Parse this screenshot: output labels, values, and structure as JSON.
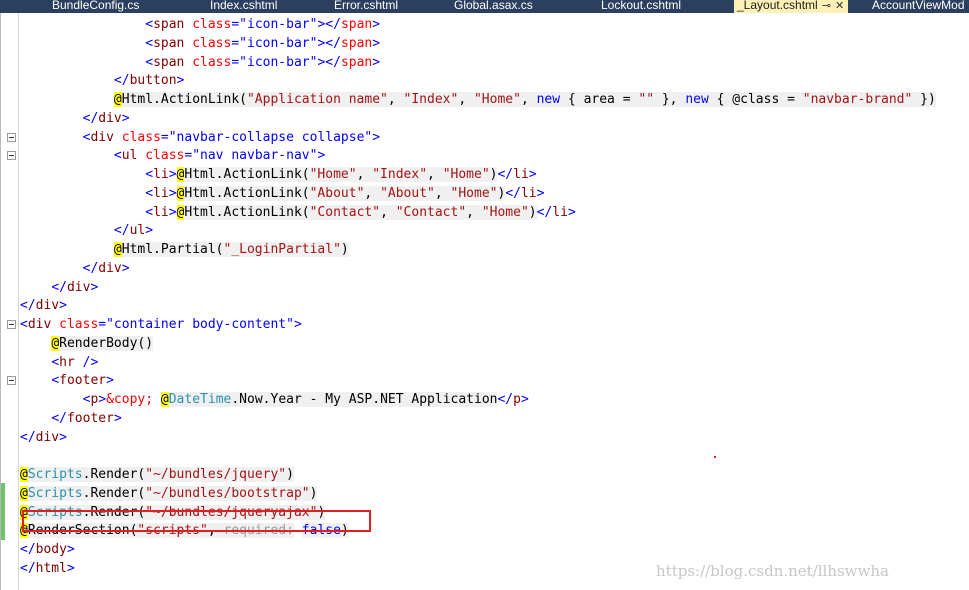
{
  "tabs": [
    {
      "label": "BundleConfig.cs",
      "active": false
    },
    {
      "label": "Index.cshtml",
      "active": false
    },
    {
      "label": "Error.cshtml",
      "active": false
    },
    {
      "label": "Global.asax.cs",
      "active": false
    },
    {
      "label": "Lockout.cshtml",
      "active": false
    },
    {
      "label": "_Layout.cshtml",
      "active": true
    },
    {
      "label": "AccountViewMod",
      "active": false
    }
  ],
  "tab_icons": {
    "pin": "pin-icon",
    "close": "close-icon"
  },
  "tab_glyphs": {
    "pin": "⊸",
    "close": "✕"
  },
  "lines": [
    [
      "                ",
      "<",
      "span",
      " ",
      "class",
      "=",
      "\"icon-bar\"",
      "></",
      "span",
      ">"
    ],
    [
      "                ",
      "<",
      "span",
      " ",
      "class",
      "=",
      "\"icon-bar\"",
      "></",
      "span",
      ">"
    ],
    [
      "                ",
      "<",
      "span",
      " ",
      "class",
      "=",
      "\"icon-bar\"",
      "></",
      "span",
      ">"
    ],
    [
      "            ",
      "</",
      "button",
      ">"
    ],
    [
      "            ",
      "@",
      "Html.ActionLink(",
      "\"Application name\"",
      ", ",
      "\"Index\"",
      ", ",
      "\"Home\"",
      ", ",
      "new",
      " { area = ",
      "\"\"",
      " }, ",
      "new",
      " { @class = ",
      "\"navbar-brand\"",
      " })"
    ],
    [
      "        ",
      "</",
      "div",
      ">"
    ],
    [
      "        ",
      "<",
      "div",
      " ",
      "class",
      "=",
      "\"navbar-collapse collapse\"",
      ">"
    ],
    [
      "            ",
      "<",
      "ul",
      " ",
      "class",
      "=",
      "\"nav navbar-nav\"",
      ">"
    ],
    [
      "                ",
      "<",
      "li",
      ">",
      "@",
      "Html.ActionLink(",
      "\"Home\"",
      ", ",
      "\"Index\"",
      ", ",
      "\"Home\"",
      ")",
      "</",
      "li",
      ">"
    ],
    [
      "                ",
      "<",
      "li",
      ">",
      "@",
      "Html.ActionLink(",
      "\"About\"",
      ", ",
      "\"About\"",
      ", ",
      "\"Home\"",
      ")",
      "</",
      "li",
      ">"
    ],
    [
      "                ",
      "<",
      "li",
      ">",
      "@",
      "Html.ActionLink(",
      "\"Contact\"",
      ", ",
      "\"Contact\"",
      ", ",
      "\"Home\"",
      ")",
      "</",
      "li",
      ">"
    ],
    [
      "            ",
      "</",
      "ul",
      ">"
    ],
    [
      "            ",
      "@",
      "Html.Partial(",
      "\"_LoginPartial\"",
      ")"
    ],
    [
      "        ",
      "</",
      "div",
      ">"
    ],
    [
      "    ",
      "</",
      "div",
      ">"
    ],
    [
      "",
      "</",
      "div",
      ">"
    ],
    [
      "",
      "<",
      "div",
      " ",
      "class",
      "=",
      "\"container body-content\"",
      ">"
    ],
    [
      "    ",
      "@",
      "RenderBody()"
    ],
    [
      "    ",
      "<",
      "hr",
      " />"
    ],
    [
      "    ",
      "<",
      "footer",
      ">"
    ],
    [
      "        ",
      "<",
      "p",
      ">",
      "&copy;",
      " ",
      "@",
      "DateTime",
      ".Now.Year",
      " - My ASP.NET Application",
      "</",
      "p",
      ">"
    ],
    [
      "    ",
      "</",
      "footer",
      ">"
    ],
    [
      "",
      "</",
      "div",
      ">"
    ],
    [
      ""
    ],
    [
      "",
      "@",
      "Scripts",
      ".Render(",
      "\"~/bundles/jquery\"",
      ")"
    ],
    [
      "",
      "@",
      "Scripts",
      ".Render(",
      "\"~/bundles/bootstrap\"",
      ")"
    ],
    [
      "",
      "@",
      "Scripts",
      ".Render(",
      "\"~/bundles/jqueryajax\"",
      ")"
    ],
    [
      "",
      "@",
      "RenderSection(",
      "\"scripts\"",
      ", ",
      "required:",
      " ",
      "false",
      ")"
    ],
    [
      "</",
      "body",
      ">"
    ],
    [
      "</",
      "html",
      ">"
    ]
  ],
  "watermark": "https://blog.csdn.net/llhswwha",
  "colors": {
    "tab_bar": "#2b3f5e",
    "active_tab": "#fdf1b8",
    "tag": "#800000",
    "attribute": "#ff0000",
    "punctuation": "#0000ff",
    "string": "#a31515",
    "keyword": "#0000ff",
    "type": "#2b91af",
    "razor_marker": "#ffff00",
    "highlight_box": "#e02020"
  }
}
